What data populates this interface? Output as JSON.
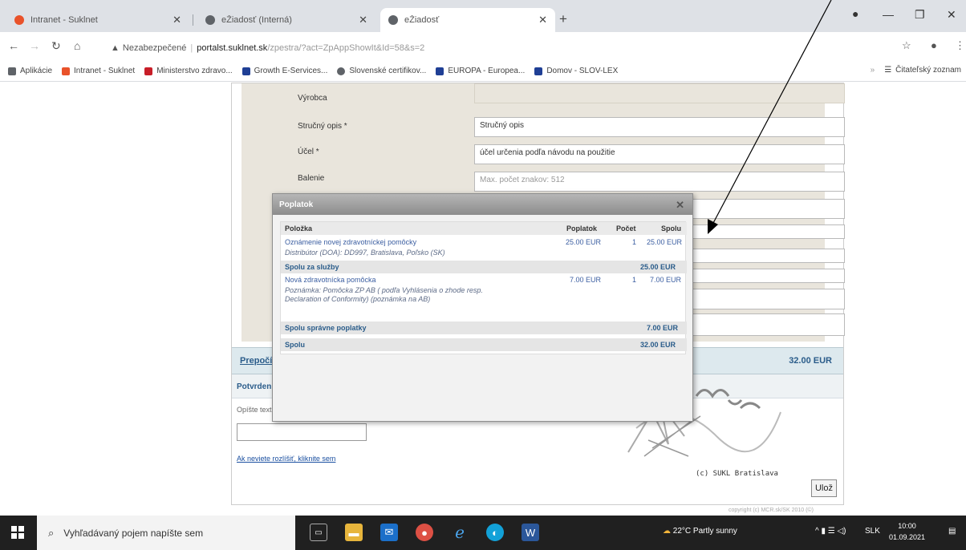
{
  "browser": {
    "tabs": [
      {
        "title": "Intranet - Suklnet",
        "active": false
      },
      {
        "title": "eŽiadosť (Interná)",
        "active": false
      },
      {
        "title": "eŽiadosť",
        "active": true
      }
    ],
    "address": {
      "security_label": "Nezabezpečené",
      "host": "portalst.suklnet.sk",
      "path": "/zpestra/?act=ZpAppShowIt&Id=58&s=2"
    },
    "bookmarks": [
      {
        "label": "Aplikácie",
        "color": "#5f6368"
      },
      {
        "label": "Intranet - Suklnet",
        "color": "#e9522a"
      },
      {
        "label": "Ministerstvo zdravo...",
        "color": "#c81e28"
      },
      {
        "label": "Growth E-Services...",
        "color": "#1f3f95"
      },
      {
        "label": "Slovenské certifikov...",
        "color": "#5f6368"
      },
      {
        "label": "EUROPA - Europea...",
        "color": "#1f3f95"
      },
      {
        "label": "Domov - SLOV-LEX",
        "color": "#1f3f95"
      }
    ],
    "reading_list": "Čitateľský zoznam"
  },
  "form": {
    "fields": [
      {
        "label": "Výrobca",
        "value": "",
        "placeholder": ""
      },
      {
        "label": "Stručný opis *",
        "value": "Stručný opis",
        "placeholder": ""
      },
      {
        "label": "Účel *",
        "value": "účel určenia podľa návodu na použitie",
        "placeholder": ""
      },
      {
        "label": "Balenie",
        "value": "",
        "placeholder": "Max. počet znakov: 512"
      }
    ],
    "summary_label": "Prepočítať",
    "summary_total": "32.00 EUR",
    "confirm_title": "Potvrdenie",
    "hint": "Opíšte text z obrázku",
    "reload_link": "Ak neviete rozlíšiť, kliknite sem",
    "copyright": "(c) SUKL Bratislava",
    "save_label": "Ulož",
    "footer": "copyright (c) MCR.sk/SK 2010 (©)"
  },
  "modal": {
    "title": "Poplatok",
    "columns": {
      "item": "Položka",
      "fee": "Poplatok",
      "count": "Počet",
      "total": "Spolu"
    },
    "items": [
      {
        "name": "Oznámenie novej zdravotníckej pomôcky",
        "sub": "Distribútor (DOA): DD997, Bratislava, Poľsko (SK)",
        "fee": "25.00 EUR",
        "count": "1",
        "total": "25.00 EUR"
      }
    ],
    "subtotal_services": {
      "label": "Spolu za služby",
      "value": "25.00 EUR"
    },
    "items2": [
      {
        "name": "Nová zdravotnícka pomôcka",
        "sub1": "Poznámka: Pomôcka ZP AB ( podľa Vyhlásenia o zhode resp.",
        "sub2": "Declaration of Conformity) (poznámka na AB)",
        "fee": "7.00 EUR",
        "count": "1",
        "total": "7.00 EUR"
      }
    ],
    "subtotal_admin": {
      "label": "Spolu správne poplatky",
      "value": "7.00 EUR"
    },
    "grand_total": {
      "label": "Spolu",
      "value": "32.00 EUR"
    }
  },
  "taskbar": {
    "search_placeholder": "Vyhľadávaný pojem napíšte sem",
    "weather": "22°C  Partly sunny",
    "language": "SLK",
    "time": "10:00",
    "date": "01.09.2021"
  }
}
